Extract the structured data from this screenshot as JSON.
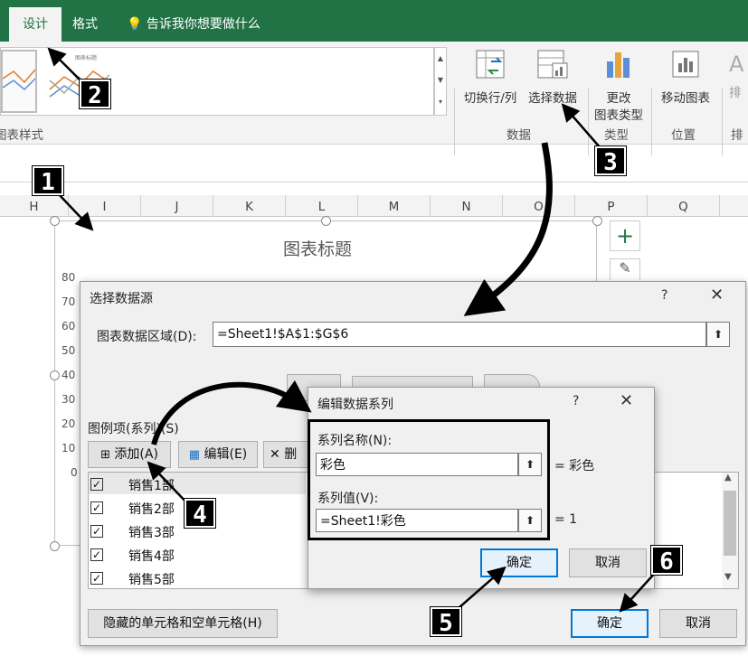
{
  "ribbon": {
    "tabs": [
      "设计",
      "格式"
    ],
    "tellme": "告诉我你想要做什么",
    "chart_styles_label": "图表样式",
    "buttons": {
      "switch_row_col": "切换行/列",
      "select_data": "选择数据",
      "change_type_1": "更改",
      "change_type_2": "图表类型",
      "move_chart": "移动图表",
      "arrange": "排"
    },
    "groups": {
      "data": "数据",
      "type": "类型",
      "location": "位置",
      "arrange": "排"
    },
    "gallery_thumb_title": "图表标题"
  },
  "grid": {
    "columns": [
      "H",
      "I",
      "J",
      "K",
      "L",
      "M",
      "N",
      "O",
      "P",
      "Q"
    ]
  },
  "chart": {
    "title": "图表标题",
    "y_ticks": [
      "80",
      "70",
      "60",
      "50",
      "40",
      "30",
      "20",
      "10",
      "0"
    ]
  },
  "dialog_select": {
    "title": "选择数据源",
    "help": "?",
    "close": "✕",
    "range_label": "图表数据区域(D):",
    "range_value": "=Sheet1!$A$1:$G$6",
    "legend_label": "图例项(系列)(S)",
    "add_button": "添加(A)",
    "edit_button": "编辑(E)",
    "delete_button": "删",
    "series": [
      "销售1部",
      "销售2部",
      "销售3部",
      "销售4部",
      "销售5部"
    ],
    "hidden_cells_button": "隐藏的单元格和空单元格(H)",
    "ok": "确定",
    "cancel": "取消"
  },
  "dialog_edit": {
    "title": "编辑数据系列",
    "help": "?",
    "close": "✕",
    "name_label": "系列名称(N):",
    "name_value": "彩色",
    "name_result": "= 彩色",
    "values_label": "系列值(V):",
    "values_value": "=Sheet1!彩色",
    "values_result": "= 1",
    "ok": "确定",
    "cancel": "取消"
  },
  "badges": [
    "1",
    "2",
    "3",
    "4",
    "5",
    "6"
  ]
}
